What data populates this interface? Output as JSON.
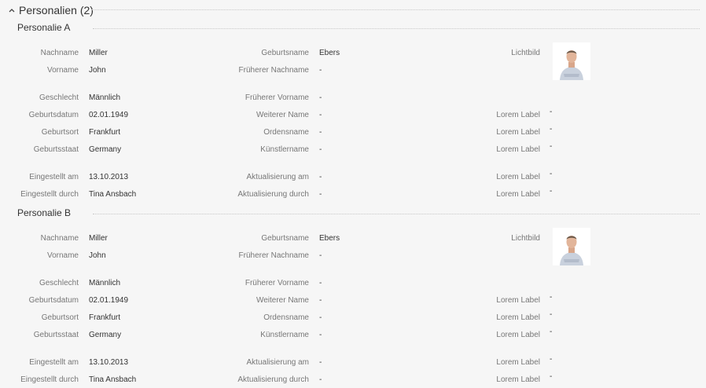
{
  "section": {
    "title": "Personalien (2)",
    "toggle_icon": "chevron-up-icon"
  },
  "persons": [
    {
      "title": "Personalie A",
      "col1": [
        {
          "label": "Nachname",
          "value": "Miller"
        },
        {
          "label": "Vorname",
          "value": "John"
        },
        {
          "label": "Geschlecht",
          "value": "Männlich"
        },
        {
          "label": "Geburtsdatum",
          "value": "02.01.1949"
        },
        {
          "label": "Geburtsort",
          "value": "Frankfurt"
        },
        {
          "label": "Geburtsstaat",
          "value": "Germany"
        },
        {
          "label": "Eingestellt am",
          "value": "13.10.2013"
        },
        {
          "label": "Eingestellt durch",
          "value": "Tina Ansbach"
        }
      ],
      "col2": [
        {
          "label": "Geburtsname",
          "value": "Ebers"
        },
        {
          "label": "Früherer Nachname",
          "value": "-"
        },
        {
          "label": "Früherer Vorname",
          "value": "-"
        },
        {
          "label": "Weiterer Name",
          "value": "-"
        },
        {
          "label": "Ordensname",
          "value": "-"
        },
        {
          "label": "Künstlername",
          "value": "-"
        },
        {
          "label": "Aktualisierung am",
          "value": "-"
        },
        {
          "label": "Aktualisierung durch",
          "value": "-"
        }
      ],
      "col3": [
        {
          "label": "Lichtbild",
          "value": ""
        },
        {
          "label": "Lorem Label",
          "value": "-"
        },
        {
          "label": "Lorem Label",
          "value": "-"
        },
        {
          "label": "Lorem Label",
          "value": "-"
        },
        {
          "label": "Lorem Label",
          "value": "-"
        },
        {
          "label": "Lorem Label",
          "value": "-"
        }
      ]
    },
    {
      "title": "Personalie B",
      "col1": [
        {
          "label": "Nachname",
          "value": "Miller"
        },
        {
          "label": "Vorname",
          "value": "John"
        },
        {
          "label": "Geschlecht",
          "value": "Männlich"
        },
        {
          "label": "Geburtsdatum",
          "value": "02.01.1949"
        },
        {
          "label": "Geburtsort",
          "value": "Frankfurt"
        },
        {
          "label": "Geburtsstaat",
          "value": "Germany"
        },
        {
          "label": "Eingestellt am",
          "value": "13.10.2013"
        },
        {
          "label": "Eingestellt durch",
          "value": "Tina Ansbach"
        }
      ],
      "col2": [
        {
          "label": "Geburtsname",
          "value": "Ebers"
        },
        {
          "label": "Früherer Nachname",
          "value": "-"
        },
        {
          "label": "Früherer Vorname",
          "value": "-"
        },
        {
          "label": "Weiterer Name",
          "value": "-"
        },
        {
          "label": "Ordensname",
          "value": "-"
        },
        {
          "label": "Künstlername",
          "value": "-"
        },
        {
          "label": "Aktualisierung am",
          "value": "-"
        },
        {
          "label": "Aktualisierung durch",
          "value": "-"
        }
      ],
      "col3": [
        {
          "label": "Lichtbild",
          "value": ""
        },
        {
          "label": "Lorem Label",
          "value": "-"
        },
        {
          "label": "Lorem Label",
          "value": "-"
        },
        {
          "label": "Lorem Label",
          "value": "-"
        },
        {
          "label": "Lorem Label",
          "value": "-"
        },
        {
          "label": "Lorem Label",
          "value": "-"
        }
      ]
    }
  ]
}
